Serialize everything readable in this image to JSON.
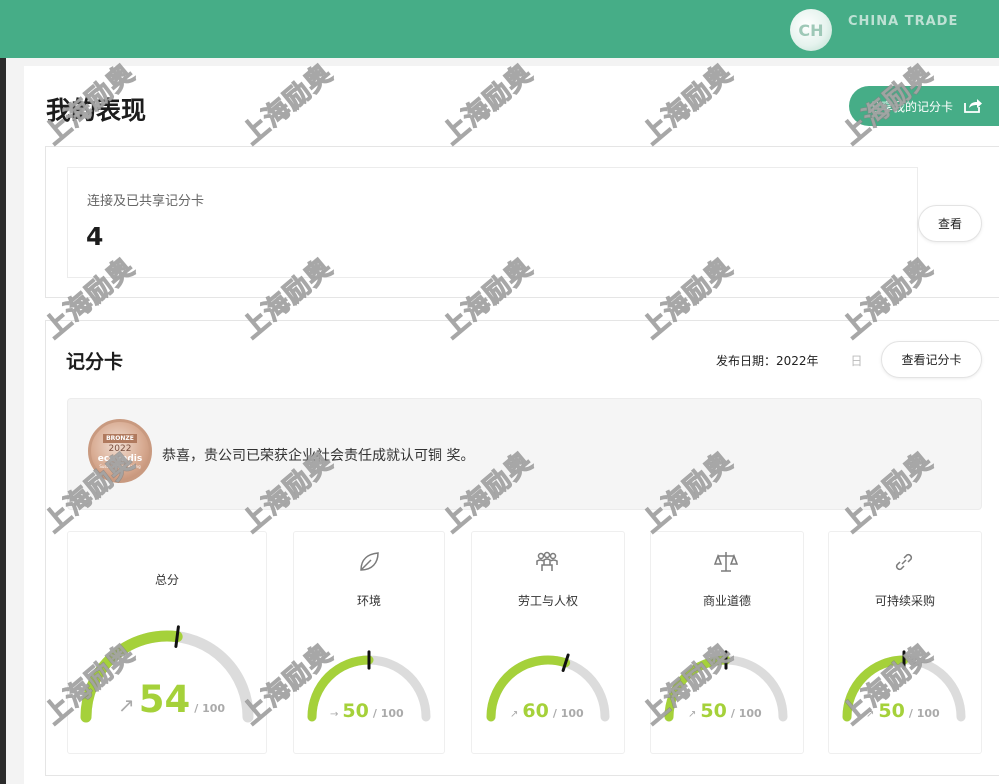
{
  "header": {
    "avatar_initials": "CH",
    "username": "CHINA TRADE"
  },
  "page": {
    "title": "我的表现",
    "share_label": "分享我的记分卡"
  },
  "connections": {
    "label": "连接及已共享记分卡",
    "count": "4",
    "view_label": "查看"
  },
  "scorecard": {
    "title": "记分卡",
    "publish_label": "发布日期：2022年",
    "publish_tail": "日",
    "view_label": "查看记分卡",
    "medal": {
      "top": "BRONZE",
      "year": "2022",
      "brand": "ecovadis",
      "sub": "Sustainability Rating"
    },
    "congrats_text": "恭喜，贵公司已荣获企业社会责任成就认可铜 奖。",
    "scores": [
      {
        "label": "总分",
        "value": 54,
        "max": "/ 100",
        "arrow": "↗",
        "icon": "none"
      },
      {
        "label": "环境",
        "value": 50,
        "max": "/ 100",
        "arrow": "→",
        "icon": "leaf-icon"
      },
      {
        "label": "劳工与人权",
        "value": 60,
        "max": "/ 100",
        "arrow": "↗",
        "icon": "people-icon"
      },
      {
        "label": "商业道德",
        "value": 50,
        "max": "/ 100",
        "arrow": "↗",
        "icon": "scale-icon"
      },
      {
        "label": "可持续采购",
        "value": 50,
        "max": "/ 100",
        "arrow": "↗",
        "icon": "link-icon"
      }
    ]
  },
  "colors": {
    "header": "#46ad87",
    "gauge_fill": "#a5d13a",
    "gauge_track": "#dcdcdc",
    "marker": "#111111"
  },
  "watermark_text": "上海励奥"
}
